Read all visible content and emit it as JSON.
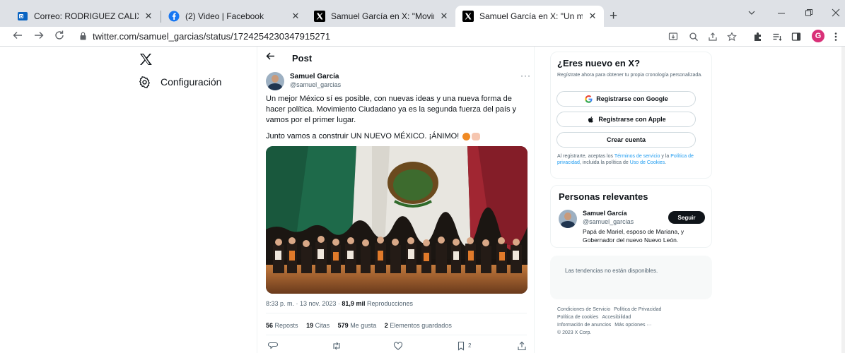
{
  "browser": {
    "tabs": [
      {
        "title": "Correo: RODRIGUEZ CALIXTO YE",
        "icon": "outlook-icon",
        "active": false
      },
      {
        "title": "(2) Video | Facebook",
        "icon": "facebook-icon",
        "active": false
      },
      {
        "title": "Samuel García en X: \"Movimiento",
        "icon": "x-icon",
        "active": false
      },
      {
        "title": "Samuel García en X: \"Un mejor M",
        "icon": "x-icon",
        "active": true
      }
    ],
    "close_glyph": "✕",
    "newtab_glyph": "+",
    "url": "twitter.com/samuel_garcias/status/1724254230347915271",
    "profile_initial": "G",
    "colors": {
      "tabstrip": "#dee1e6",
      "profile": "#d93078",
      "accent": "#1d9bf0"
    }
  },
  "sidebar": {
    "settings_label": "Configuración"
  },
  "post": {
    "header_title": "Post",
    "author_name": "Samuel García",
    "author_handle": "@samuel_garcias",
    "text_main": "Un mejor México sí es posible, con nuevas ideas y una nueva forma de hacer política. Movimiento Ciudadano ya es la segunda fuerza del país y vamos por el primer lugar.",
    "text_second": "Junto vamos a construir UN NUEVO MÉXICO. ¡ÁNIMO!",
    "time": "8:33 p. m. · 13 nov. 2023 ·",
    "views_count": "81,9 mil",
    "views_label": "Reproducciones",
    "stats": [
      {
        "count": "56",
        "label": "Reposts"
      },
      {
        "count": "19",
        "label": "Citas"
      },
      {
        "count": "579",
        "label": "Me gusta"
      },
      {
        "count": "2",
        "label": "Elementos guardados"
      }
    ],
    "bookmark_count": "2"
  },
  "signup": {
    "title": "¿Eres nuevo en X?",
    "description": "Regístrate ahora para obtener tu propia cronología personalizada.",
    "google_label": "Registrarse con Google",
    "apple_label": "Registrarse con Apple",
    "create_label": "Crear cuenta",
    "terms_prefix": "Al registrarte, aceptas los ",
    "terms_link": "Términos de servicio",
    "terms_mid": " y la ",
    "privacy_link": "Política de privacidad",
    "terms_mid2": ", incluida la política de ",
    "cookies_link": "Uso de Cookies",
    "terms_end": "."
  },
  "persons": {
    "title": "Personas relevantes",
    "name": "Samuel García",
    "handle": "@samuel_garcias",
    "bio": "Papá de Mariel, esposo de Mariana, y Gobernador del nuevo Nuevo León.",
    "follow_label": "Seguir"
  },
  "trends": {
    "message": "Las tendencias no están disponibles."
  },
  "footer": {
    "links": [
      "Condiciones de Servicio",
      "Política de Privacidad",
      "Política de cookies",
      "Accesibilidad",
      "Información de anuncios",
      "Más opciones ···",
      "© 2023 X Corp."
    ]
  }
}
